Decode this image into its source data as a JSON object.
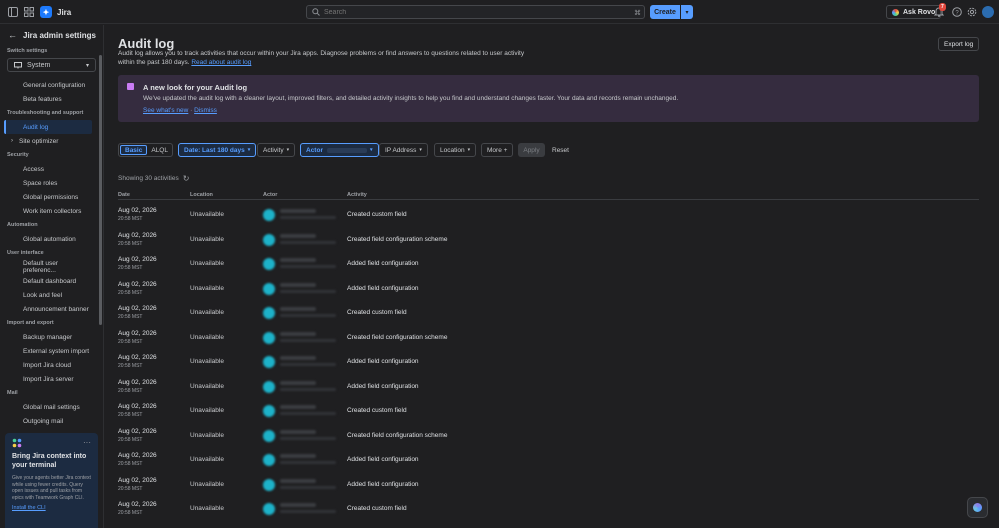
{
  "topbar": {
    "brand": "Jira",
    "search_placeholder": "Search",
    "create_label": "Create",
    "ask_rovo_label": "Ask Rovo",
    "notification_count": "7"
  },
  "sidebar": {
    "title": "Jira admin settings",
    "switch_label": "Switch settings",
    "switch_value": "System",
    "items_top": [
      "General configuration",
      "Beta features"
    ],
    "sec_troubleshooting": "Troubleshooting and support",
    "audit_log": "Audit log",
    "site_optimizer": "Site optimizer",
    "sec_security": "Security",
    "security_items": [
      "Access",
      "Space roles",
      "Global permissions",
      "Work item collectors"
    ],
    "sec_automation": "Automation",
    "automation_items": [
      "Global automation"
    ],
    "sec_ui": "User interface",
    "ui_items": [
      "Default user preferenc...",
      "Default dashboard",
      "Look and feel",
      "Announcement banner"
    ],
    "sec_import": "Import and export",
    "import_items": [
      "Backup manager",
      "External system import",
      "Import Jira cloud",
      "Import Jira server"
    ],
    "sec_mail": "Mail",
    "mail_items": [
      "Global mail settings",
      "Outgoing mail"
    ],
    "promo": {
      "title": "Bring Jira context into your terminal",
      "body": "Give your agents better Jira context while using fewer credits. Query open issues and pull tasks from epics with Teamwork Graph CLI.",
      "link": "Install the CLI"
    }
  },
  "main": {
    "title": "Audit log",
    "desc_line1": "Audit log allows you to track activities that occur within your Jira apps. Diagnose problems or find answers to questions related to user",
    "desc_line2": "activity within the past 180 days.",
    "desc_link": "Read about audit log",
    "export_label": "Export log",
    "banner": {
      "title": "A new look for your Audit log",
      "text": "We've updated the audit log with a cleaner layout, improved filters, and detailed activity insights to help you find and understand changes faster. Your data and records remain unchanged.",
      "link1": "See what's new",
      "sep": "·",
      "link2": "Dismiss"
    },
    "filters": {
      "basic": "Basic",
      "aql": "ALQL",
      "date": "Date: Last 180 days",
      "activity": "Activity",
      "actor": "Actor",
      "ip": "IP Address",
      "location": "Location",
      "more": "More +",
      "apply": "Apply",
      "reset": "Reset"
    },
    "showing": "Showing 30 activities",
    "columns": [
      "Date",
      "Location",
      "Actor",
      "Activity"
    ],
    "rows": [
      {
        "date": "Aug 02, 2026",
        "time": "20:58 MST",
        "location": "Unavailable",
        "activity": "Created custom field"
      },
      {
        "date": "Aug 02, 2026",
        "time": "20:58 MST",
        "location": "Unavailable",
        "activity": "Created field configuration scheme"
      },
      {
        "date": "Aug 02, 2026",
        "time": "20:58 MST",
        "location": "Unavailable",
        "activity": "Added field configuration"
      },
      {
        "date": "Aug 02, 2026",
        "time": "20:58 MST",
        "location": "Unavailable",
        "activity": "Added field configuration"
      },
      {
        "date": "Aug 02, 2026",
        "time": "20:58 MST",
        "location": "Unavailable",
        "activity": "Created custom field"
      },
      {
        "date": "Aug 02, 2026",
        "time": "20:58 MST",
        "location": "Unavailable",
        "activity": "Created field configuration scheme"
      },
      {
        "date": "Aug 02, 2026",
        "time": "20:58 MST",
        "location": "Unavailable",
        "activity": "Added field configuration"
      },
      {
        "date": "Aug 02, 2026",
        "time": "20:58 MST",
        "location": "Unavailable",
        "activity": "Added field configuration"
      },
      {
        "date": "Aug 02, 2026",
        "time": "20:58 MST",
        "location": "Unavailable",
        "activity": "Created custom field"
      },
      {
        "date": "Aug 02, 2026",
        "time": "20:58 MST",
        "location": "Unavailable",
        "activity": "Created field configuration scheme"
      },
      {
        "date": "Aug 02, 2026",
        "time": "20:58 MST",
        "location": "Unavailable",
        "activity": "Added field configuration"
      },
      {
        "date": "Aug 02, 2026",
        "time": "20:58 MST",
        "location": "Unavailable",
        "activity": "Added field configuration"
      },
      {
        "date": "Aug 02, 2026",
        "time": "20:58 MST",
        "location": "Unavailable",
        "activity": "Created custom field"
      }
    ]
  },
  "colors": {
    "accent": "#579dff",
    "background": "#1f1f21",
    "banner": "#352c3f"
  }
}
